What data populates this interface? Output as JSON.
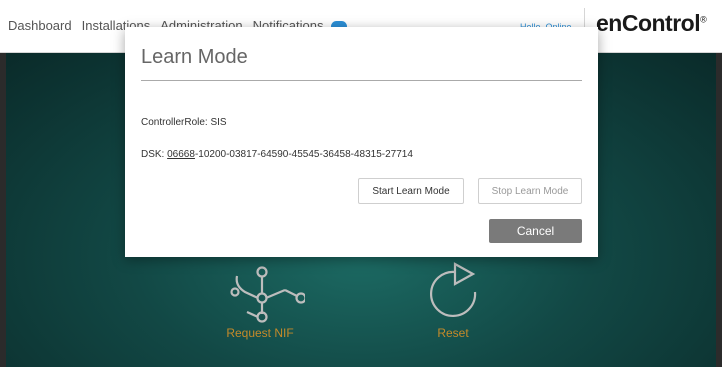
{
  "nav": {
    "items": [
      "Dashboard",
      "Installations",
      "Administration",
      "Notifications"
    ],
    "user_link": "Hello, Online"
  },
  "brand": {
    "name": "enControl",
    "mark": "®"
  },
  "modal": {
    "title": "Learn Mode",
    "controller_role": "ControllerRole: SIS",
    "dsk_label": "DSK: ",
    "dsk_first": "06668",
    "dsk_rest": "-10200-03817-64590-45545-36458-48315-27714",
    "start_button": "Start Learn Mode",
    "stop_button": "Stop Learn Mode",
    "cancel_button": "Cancel"
  },
  "actions": [
    {
      "label": "Request NIF",
      "icon": "network-nodes-icon"
    },
    {
      "label": "Reset",
      "icon": "reset-arrow-icon"
    }
  ],
  "colors": {
    "accent": "#2c8fd6",
    "action_label": "#c48a2a",
    "cancel_bg": "#7a7a7a",
    "backdrop": "#124845"
  }
}
